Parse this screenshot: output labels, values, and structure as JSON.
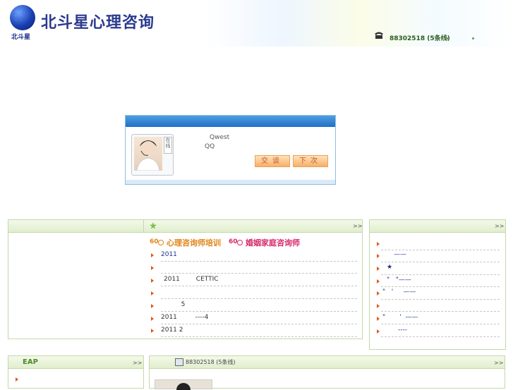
{
  "header": {
    "brand": "北斗星心理咨询",
    "logo_sub": "北斗星",
    "phone": "88302518 (5条线)",
    "phone_icon": "telephone-icon"
  },
  "popup": {
    "online_tag": "在线",
    "line1": "Qwest",
    "line2": "QQ",
    "btn_talk": "交谈",
    "btn_next": "下次"
  },
  "panel_main": {
    "more": ">>",
    "star_icon": "star-icon",
    "banner_num1": "60",
    "banner_text1": "心理咨询师培训",
    "banner_num2": "60",
    "banner_text2": "婚姻家庭咨询师",
    "items": [
      "2011",
      "",
      "2011        CETTIC",
      "",
      "          5",
      "2011         ----4",
      "2011 2"
    ]
  },
  "panel_right": {
    "more": ">>",
    "items": [
      "",
      "——",
      "★",
      "\"   \"——",
      "\"   '     ——",
      "",
      "\"       '  ——",
      "----"
    ]
  },
  "panel_eap": {
    "title": "EAP",
    "more": ">>"
  },
  "panel_contact": {
    "phone": "88302518 (5条线)",
    "more": ">>"
  }
}
